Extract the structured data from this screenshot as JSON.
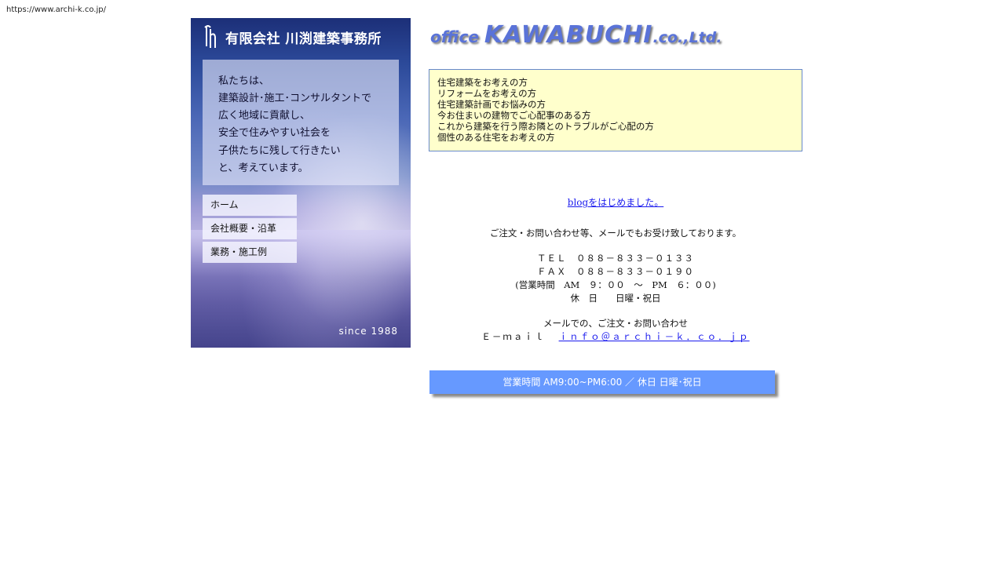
{
  "browser": {
    "url": "https://www.archi-k.co.jp/"
  },
  "banner": {
    "company_name": "有限会社 川渕建築事務所",
    "motto": [
      "私たちは、",
      "建築設計･施工･コンサルタントで",
      "広く地域に貢献し、",
      "安全で住みやすい社会を",
      "子供たちに残して行きたい",
      "と、考えています。"
    ],
    "nav": [
      {
        "label": "ホーム"
      },
      {
        "label": "会社概要・沿革"
      },
      {
        "label": "業務・施工例"
      }
    ],
    "since": "since 1988"
  },
  "logo": {
    "word1": "office ",
    "word2": "KAWABUCHI",
    "word3": ".co.,Ltd."
  },
  "targets": [
    "住宅建築をお考えの方",
    "リフォームをお考えの方",
    "住宅建築計画でお悩みの方",
    "今お住まいの建物でご心配事のある方",
    "これから建築を行う際お隣とのトラブルがご心配の方",
    "個性のある住宅をお考えの方"
  ],
  "blog_link": "blogをはじめました。",
  "contact": {
    "intro": "ご注文・お問い合わせ等、メールでもお受け致しております。",
    "tel": "ＴＥＬ　０８８－８３３－０１３３",
    "fax": "ＦＡＸ　０８８－８３３－０１９０",
    "hours": "(営業時間　AM　９：００　～　PM　６：００)",
    "holiday": "休　日　　日曜・祝日",
    "mail_intro": "メールでの、ご注文・お問い合わせ",
    "email_label": "Ｅ－ｍａｉｌ　",
    "email": "ｉｎｆｏ＠ａｒｃｈｉ－ｋ．ｃｏ．ｊｐ"
  },
  "hours_bar": "営業時間  AM9:00~PM6:00  ／  休日  日曜･祝日",
  "colors": {
    "target_box_bg": "#ffffcc",
    "target_box_border": "#6688cc",
    "hours_bar_bg": "#6699ff",
    "link": "#1a1aee"
  }
}
